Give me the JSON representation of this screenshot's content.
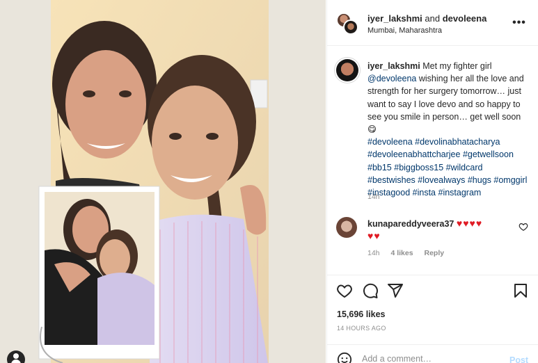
{
  "header": {
    "user1": "iyer_lakshmi",
    "conjunction": "and",
    "user2": "devoleena",
    "location": "Mumbai, Maharashtra",
    "more_icon": "more-horizontal-icon"
  },
  "caption": {
    "username": "iyer_lakshmi",
    "text_before": "Met my fighter girl",
    "mention": "@devoleena",
    "text_after": "wishing her all the love and strength for her surgery tomorrow… just want to say I love devo and so happy to see you smile in person… get well soon",
    "emoji": "😋",
    "hashtags": [
      "#devoleena",
      "#devolinabhatacharya",
      "#devoleenabhattcharjee",
      "#getwellsoon",
      "#bb15",
      "#biggboss15",
      "#wildcard",
      "#bestwishes",
      "#lovealways",
      "#hugs",
      "#omggirl",
      "#instagood",
      "#insta",
      "#instagram"
    ],
    "time": "14h"
  },
  "comment": {
    "username": "kunapareddyveera37",
    "hearts_line1": "♥♥♥♥",
    "hearts_line2": "♥♥",
    "time": "14h",
    "likes": "4 likes",
    "reply": "Reply"
  },
  "actions": {
    "icons": [
      "heart-icon",
      "comment-icon",
      "share-icon",
      "bookmark-icon"
    ]
  },
  "likes_count": "15,696 likes",
  "posted_ago": "14 HOURS AGO",
  "add_comment": {
    "placeholder": "Add a comment…",
    "post_label": "Post"
  },
  "colors": {
    "link": "#00376b",
    "muted": "#8e8e8e",
    "heart": "#e01b24",
    "post_disabled": "#b3dbff"
  }
}
